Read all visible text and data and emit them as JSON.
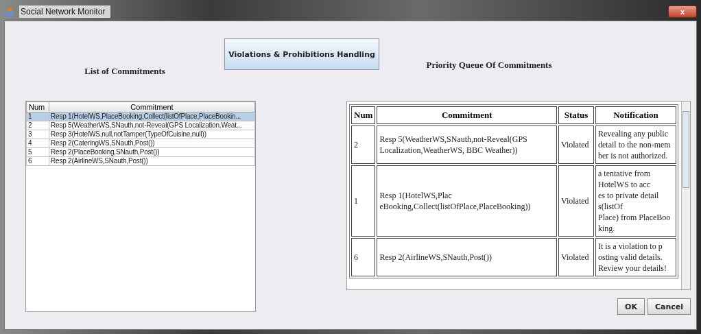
{
  "window": {
    "title": "Social Network Monitor",
    "close": "x"
  },
  "labels": {
    "list": "List of Commitments",
    "action": "Violations & Prohibitions  Handling",
    "queue": "Priority Queue Of Commitments"
  },
  "list_table": {
    "columns": [
      "Num",
      "Commitment"
    ],
    "rows": [
      {
        "num": "1",
        "commitment": "Resp 1(HotelWS,PlaceBooking,Collect(listOfPlace,PlaceBookin...",
        "selected": true
      },
      {
        "num": "2",
        "commitment": "Resp 5(WeatherWS,SNauth,not-Reveal(GPS Localization,Weat...",
        "selected": false
      },
      {
        "num": "3",
        "commitment": "Resp 3(HotelWS,null,notTamper(TypeOfCuisine,null))",
        "selected": false
      },
      {
        "num": "4",
        "commitment": "Resp 2(CateringWS,SNauth,Post())",
        "selected": false
      },
      {
        "num": "5",
        "commitment": "Resp 2(PlaceBooking,SNauth,Post())",
        "selected": false
      },
      {
        "num": "6",
        "commitment": "Resp 2(AirlineWS,SNauth,Post())",
        "selected": false
      }
    ]
  },
  "queue_table": {
    "columns": [
      "Num",
      "Commitment",
      "Status",
      "Notification"
    ],
    "rows": [
      {
        "num": "2",
        "commitment": "Resp 5(WeatherWS,SNauth,not-Reveal(GPS\nLocalization,WeatherWS, BBC Weather))",
        "status": "Violated",
        "notification": "Revealing any public\ndetail to the non-mem\nber is not authorized."
      },
      {
        "num": "1",
        "commitment": "Resp 1(HotelWS,Plac\neBooking,Collect(listOfPlace,PlaceBooking))",
        "status": "Violated",
        "notification": "a tentative from\n HotelWS to acc\nes to private detail\ns(listOf\nPlace) from PlaceBoo\nking."
      },
      {
        "num": "6",
        "commitment": "Resp 2(AirlineWS,SNauth,Post())",
        "status": "Violated",
        "notification": "It is a violation to p\nosting valid details.\n Review your details!"
      }
    ]
  },
  "buttons": [
    "OK",
    "Cancel"
  ]
}
